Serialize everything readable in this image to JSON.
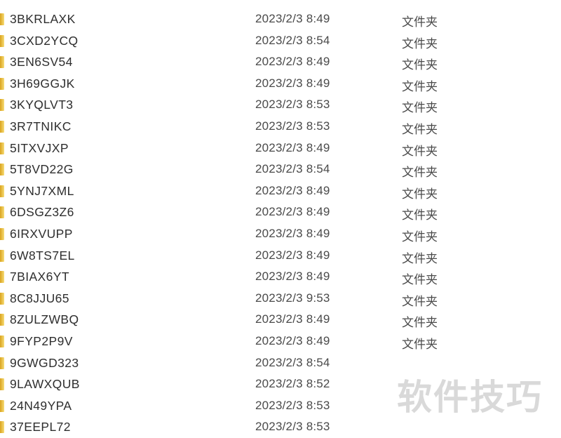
{
  "files": [
    {
      "name": "3BKRLAXK",
      "modified": "2023/2/3 8:49",
      "type": "文件夹"
    },
    {
      "name": "3CXD2YCQ",
      "modified": "2023/2/3 8:54",
      "type": "文件夹"
    },
    {
      "name": "3EN6SV54",
      "modified": "2023/2/3 8:49",
      "type": "文件夹"
    },
    {
      "name": "3H69GGJK",
      "modified": "2023/2/3 8:49",
      "type": "文件夹"
    },
    {
      "name": "3KYQLVT3",
      "modified": "2023/2/3 8:53",
      "type": "文件夹"
    },
    {
      "name": "3R7TNIKC",
      "modified": "2023/2/3 8:53",
      "type": "文件夹"
    },
    {
      "name": "5ITXVJXP",
      "modified": "2023/2/3 8:49",
      "type": "文件夹"
    },
    {
      "name": "5T8VD22G",
      "modified": "2023/2/3 8:54",
      "type": "文件夹"
    },
    {
      "name": "5YNJ7XML",
      "modified": "2023/2/3 8:49",
      "type": "文件夹"
    },
    {
      "name": "6DSGZ3Z6",
      "modified": "2023/2/3 8:49",
      "type": "文件夹"
    },
    {
      "name": "6IRXVUPP",
      "modified": "2023/2/3 8:49",
      "type": "文件夹"
    },
    {
      "name": "6W8TS7EL",
      "modified": "2023/2/3 8:49",
      "type": "文件夹"
    },
    {
      "name": "7BIAX6YT",
      "modified": "2023/2/3 8:49",
      "type": "文件夹"
    },
    {
      "name": "8C8JJU65",
      "modified": "2023/2/3 9:53",
      "type": "文件夹"
    },
    {
      "name": "8ZULZWBQ",
      "modified": "2023/2/3 8:49",
      "type": "文件夹"
    },
    {
      "name": "9FYP2P9V",
      "modified": "2023/2/3 8:49",
      "type": "文件夹"
    },
    {
      "name": "9GWGD323",
      "modified": "2023/2/3 8:54",
      "type": ""
    },
    {
      "name": "9LAWXQUB",
      "modified": "2023/2/3 8:52",
      "type": ""
    },
    {
      "name": "24N49YPA",
      "modified": "2023/2/3 8:53",
      "type": ""
    },
    {
      "name": "37EEPL72",
      "modified": "2023/2/3 8:53",
      "type": ""
    }
  ],
  "watermark": "软件技巧",
  "colors": {
    "folder": "#e8bd3c",
    "text": "#2e2e2e",
    "watermark": "#d9d9d9"
  }
}
